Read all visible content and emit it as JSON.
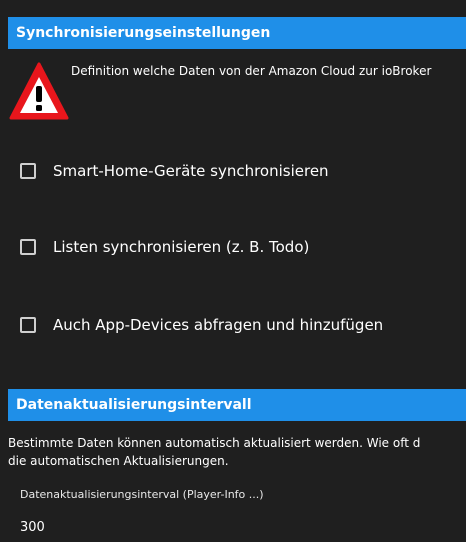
{
  "sync_section": {
    "title": "Synchronisierungseinstellungen",
    "warning_text": "Definition welche Daten von der Amazon Cloud zur ioBroker",
    "options": [
      {
        "label": "Smart-Home-Geräte synchronisieren",
        "checked": false
      },
      {
        "label": "Listen synchronisieren (z. B. Todo)",
        "checked": false
      },
      {
        "label": "Auch App-Devices abfragen und hinzufügen",
        "checked": false
      }
    ]
  },
  "interval_section": {
    "title": "Datenaktualisierungsintervall",
    "description_line1": "Bestimmte Daten können automatisch aktualisiert werden. Wie oft d",
    "description_line2": "die automatischen Aktualisierungen.",
    "field_label": "Datenaktualisierungsinterval (Player-Info ...)",
    "field_value": "300"
  },
  "colors": {
    "header_bg": "#1f8fe8",
    "page_bg": "#1f1f1f",
    "warning_red": "#e8161c"
  }
}
